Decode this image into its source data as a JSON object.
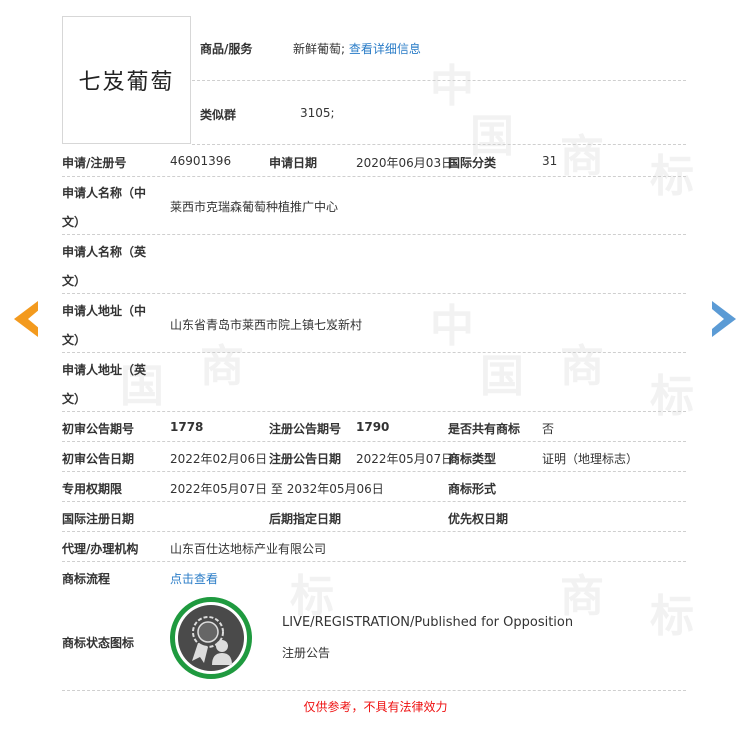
{
  "logo_text": "七岌葡萄",
  "watermark": [
    "中",
    "国",
    "商",
    "标"
  ],
  "goods": {
    "label": "商品/服务",
    "value": "新鲜葡萄;",
    "link": "查看详细信息"
  },
  "class_group": {
    "label": "类似群",
    "value": "3105;"
  },
  "reg": {
    "label": "申请/注册号",
    "value": "46901396",
    "date_label": "申请日期",
    "date_value": "2020年06月03日",
    "intl_label": "国际分类",
    "intl_value": "31"
  },
  "applicant_cn": {
    "label1": "申请人名称（中",
    "label2": "文）",
    "value": "莱西市克瑞森葡萄种植推广中心"
  },
  "applicant_en": {
    "label1": "申请人名称（英",
    "label2": "文）",
    "value": ""
  },
  "address_cn": {
    "label1": "申请人地址（中",
    "label2": "文）",
    "value": "山东省青岛市莱西市院上镇七岌新村"
  },
  "address_en": {
    "label1": "申请人地址（英",
    "label2": "文）",
    "value": ""
  },
  "prelim": {
    "label": "初审公告期号",
    "value": "1778",
    "reg_label": "注册公告期号",
    "reg_value": "1790",
    "shared_label": "是否共有商标",
    "shared_value": "否"
  },
  "prelim_date": {
    "label": "初审公告日期",
    "value": "2022年02月06日",
    "reg_label": "注册公告日期",
    "reg_value": "2022年05月07日",
    "type_label": "商标类型",
    "type_value": "证明（地理标志）"
  },
  "term": {
    "label": "专用权期限",
    "value": "2022年05月07日 至 2032年05月06日",
    "form_label": "商标形式",
    "form_value": ""
  },
  "intl_reg": {
    "label": "国际注册日期",
    "value": "",
    "later_label": "后期指定日期",
    "later_value": "",
    "priority_label": "优先权日期",
    "priority_value": ""
  },
  "agent": {
    "label": "代理/办理机构",
    "value": "山东百仕达地标产业有限公司"
  },
  "flow": {
    "label": "商标流程",
    "link": "点击查看"
  },
  "status": {
    "label": "商标状态图标",
    "en": "LIVE/REGISTRATION/Published for Opposition",
    "cn": "注册公告"
  },
  "disclaimer": "仅供参考，不具有法律效力",
  "colors": {
    "link": "#2a7cc7",
    "accent_green": "#1f9a3f",
    "arrow_left": "#f39a1e",
    "arrow_right": "#5b9bd5",
    "disclaimer": "#ee1111"
  }
}
